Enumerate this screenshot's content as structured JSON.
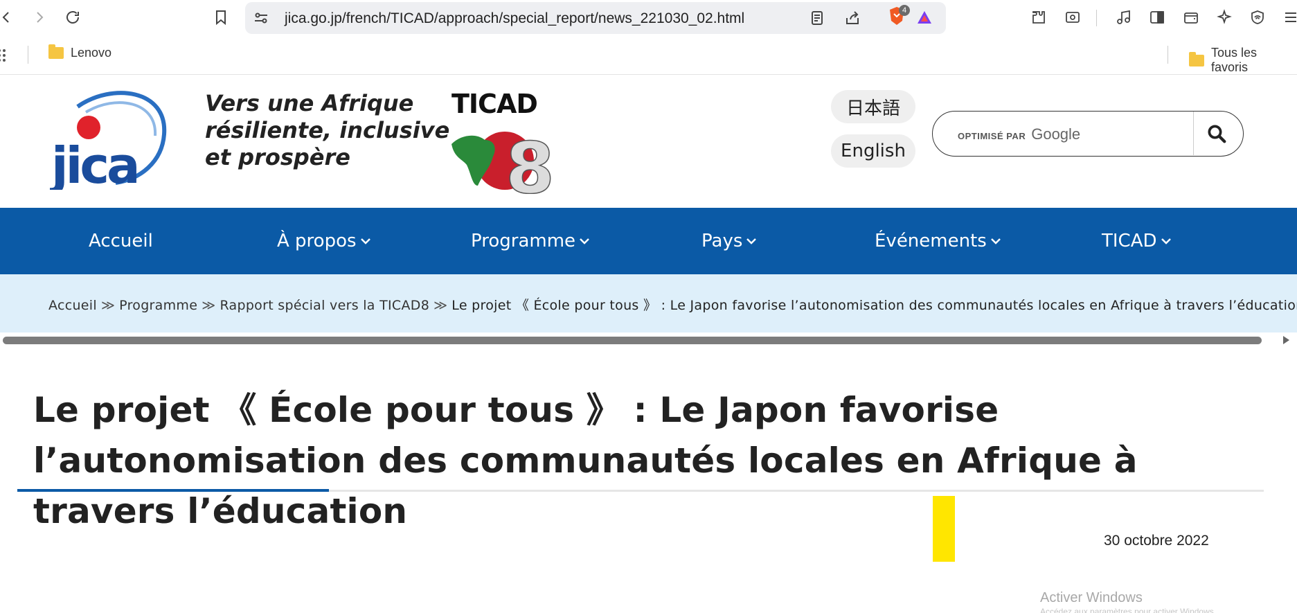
{
  "browser": {
    "url": "jica.go.jp/french/TICAD/approach/special_report/news_221030_02.html",
    "shields_count": "4"
  },
  "bookmarks": {
    "items": [
      "Lenovo"
    ],
    "all_bookmarks": "Tous les favoris"
  },
  "header": {
    "tagline": [
      "Vers une Afrique",
      "résiliente, inclusive",
      "et prospère"
    ],
    "ticad_word": "TICAD",
    "lang_japanese": "日本語",
    "lang_english": "English",
    "search_prefix": "OPTIMISÉ PAR",
    "search_brand": "Google"
  },
  "nav": {
    "items": [
      "Accueil",
      "À propos",
      "Programme",
      "Pays",
      "Événements",
      "TICAD"
    ]
  },
  "breadcrumb": {
    "items": [
      "Accueil",
      "Programme",
      "Rapport spécial vers la TICAD8"
    ],
    "current": "Le projet 《 École pour tous 》 : Le Japon favorise l’autonomisation des communautés locales en Afrique à travers l’éducation"
  },
  "article": {
    "title": "Le projet 《 École pour tous 》 : Le Japon favorise l’autonomisation des communautés locales en Afrique à travers l’éducation",
    "date": "30 octobre 2022"
  },
  "os": {
    "watermark": "Activer Windows",
    "watermark_sub": "Accédez aux paramètres pour activer Windows."
  },
  "colors": {
    "nav_bg": "#0b5aa6",
    "breadcrumb_bg": "#deeffa",
    "accent_yellow": "#ffe600"
  }
}
